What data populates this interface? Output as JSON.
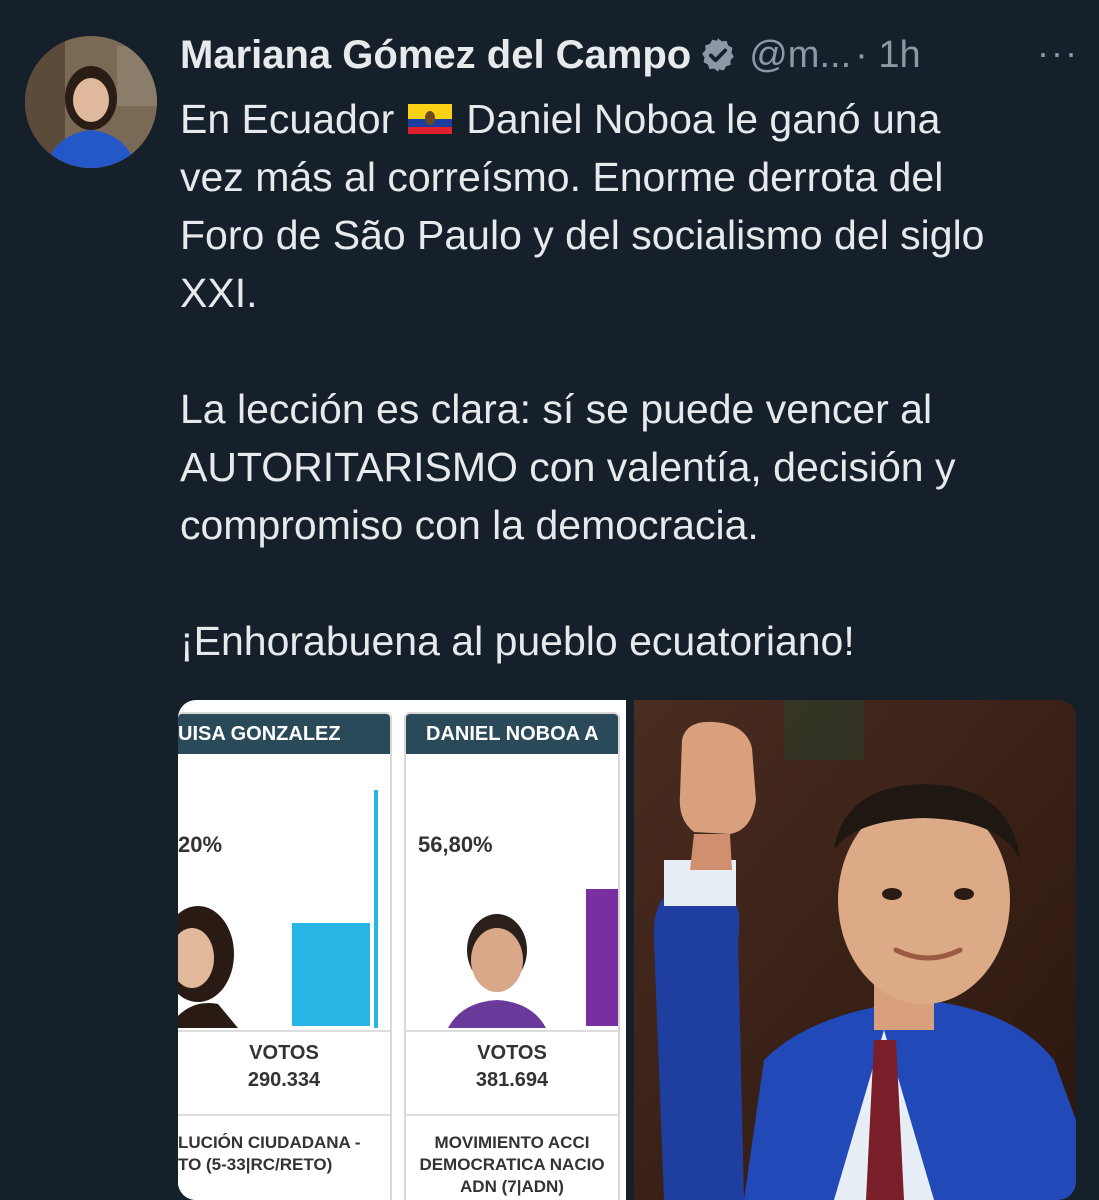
{
  "tweet": {
    "author_name": "Mariana Gómez del Campo",
    "handle": "@m...",
    "time": "· 1h",
    "more_label": "···",
    "text": {
      "line1_before_flag": "En Ecuador",
      "line1_after_flag": "Daniel Noboa le ganó una",
      "line2": "vez más al correísmo. Enorme derrota del",
      "line3": "Foro de São Paulo y del socialismo del siglo",
      "line4": "XXI.",
      "para2_line1": "La lección es clara: sí se puede vencer al",
      "para2_line2": "AUTORITARISMO con valentía, decisión y",
      "para2_line3": "compromiso con la democracia.",
      "para3": "¡Enhorabuena al pueblo ecuatoriano!"
    }
  },
  "media": {
    "candidates": [
      {
        "header": "UISA GONZALEZ",
        "percent": "20%",
        "votes_label": "VOTOS",
        "votes": "290.334",
        "party": "LUCIÓN CIUDADANA -\nTO (5-33|RC/RETO)",
        "bar_value_fraction": 0.43,
        "color": "#29b6e6"
      },
      {
        "header": "DANIEL NOBOA A",
        "percent": "56,80%",
        "votes_label": "VOTOS",
        "votes": "381.694",
        "party": "MOVIMIENTO ACCI\nDEMOCRATICA NACIO\nADN (7|ADN)",
        "bar_value_fraction": 0.57,
        "color": "#7a2fa0"
      }
    ]
  },
  "colors": {
    "background": "#15202b",
    "text": "#e7e9ea",
    "muted": "#8b98a5",
    "verified": "#8b98a5"
  }
}
